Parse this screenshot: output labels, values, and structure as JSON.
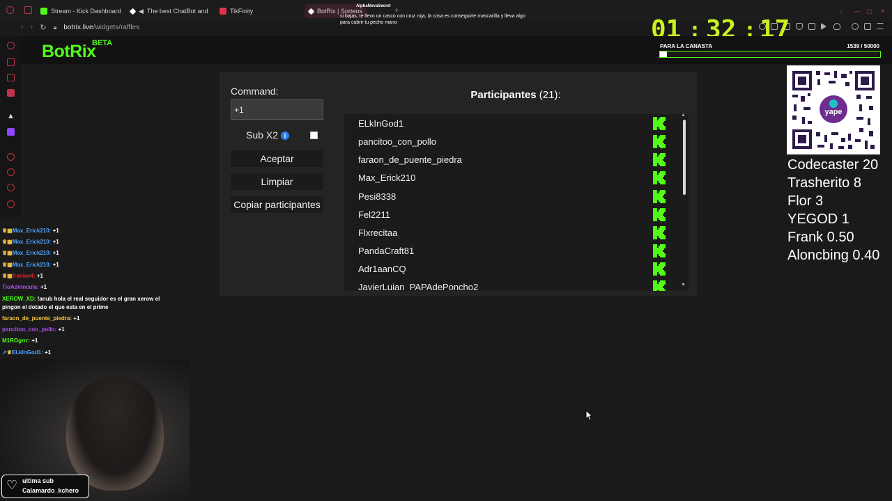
{
  "browser": {
    "tabs": [
      {
        "label": "Stream - Kick Dashboard",
        "color": "#53fc18"
      },
      {
        "label": "The best ChatBot and",
        "color": "#ffffff"
      },
      {
        "label": "TikFinity",
        "color": "#e0334a"
      },
      {
        "label": "BotRix | Sorteos",
        "color": "#ffffff"
      }
    ],
    "url_host": "botrix.live",
    "url_path": "/widgets/raffles"
  },
  "notification": {
    "user": "AlphaNovaSecret",
    "text": "si bajas, te llevo un casco con cruz roja, la cosa es conseguirte mascarilla y lleva algo para cubrir tu pecho mano"
  },
  "timer": {
    "hours": "01",
    "minutes": "32",
    "seconds": "17",
    "sep": ":"
  },
  "goal": {
    "label": "PARA LA CANASTA",
    "current": "1539",
    "sep": "/",
    "target": "50000",
    "progress": 0.031
  },
  "site": {
    "logo": "BotRix",
    "beta": "BETA"
  },
  "raffle": {
    "command_label": "Command:",
    "command_value": "+1",
    "sub_label": "Sub X2",
    "info_icon": "i",
    "accept_label": "Aceptar",
    "clear_label": "Limpiar",
    "copy_label": "Copiar participantes",
    "participants_title": "Participantes",
    "participants_count": "(21):",
    "participants": [
      "ELkInGod1",
      "pancitoo_con_pollo",
      "faraon_de_puente_piedra",
      "Max_Erick210",
      "Pesi8338",
      "Fel2211",
      "Flxrecitaa",
      "PandaCraft81",
      "Adr1aanCQ",
      "JavierLuian_PAPAdePoncho2"
    ]
  },
  "leaderboard": [
    "Codecaster 20",
    "Trasherito 8",
    "Flor 3",
    "YEGOD 1",
    "Frank 0.50",
    "Aloncbing 0.40"
  ],
  "chat": [
    {
      "user": "Max_Erick210:",
      "msg": "+1",
      "color": "#4da3ff"
    },
    {
      "user": "Max_Erick210:",
      "msg": "+1",
      "color": "#4da3ff"
    },
    {
      "user": "Max_Erick210:",
      "msg": "+1",
      "color": "#4da3ff"
    },
    {
      "user": "Max_Erick210:",
      "msg": "+1",
      "color": "#4da3ff"
    },
    {
      "user": "frankw4:",
      "msg": "+1",
      "color": "#d8232a"
    },
    {
      "user": "TioAdvincula:",
      "msg": "+1",
      "color": "#b04ef0"
    },
    {
      "user": "XEROW_XD:",
      "msg": "!anub hola el real seguidor es el gran xerow el",
      "color": "#53fc18"
    },
    {
      "user": "",
      "msg": "pingon el dotado el que esta en el prime",
      "color": "#ffffff"
    },
    {
      "user": "faraon_de_puente_piedra:",
      "msg": "+1",
      "color": "#f5c542"
    },
    {
      "user": "pancitoo_con_pollo:",
      "msg": "+1",
      "color": "#b04ef0"
    },
    {
      "user": "M1ROgrrr:",
      "msg": "+1",
      "color": "#53fc18"
    },
    {
      "user": "ELkInGod1:",
      "msg": "+1",
      "color": "#4da3ff"
    }
  ],
  "last_sub": {
    "title": "ultima sub",
    "name": "Calamardo_kchero"
  },
  "colors": {
    "kick_green": "#53fc18",
    "timer": "#c8f31e"
  }
}
